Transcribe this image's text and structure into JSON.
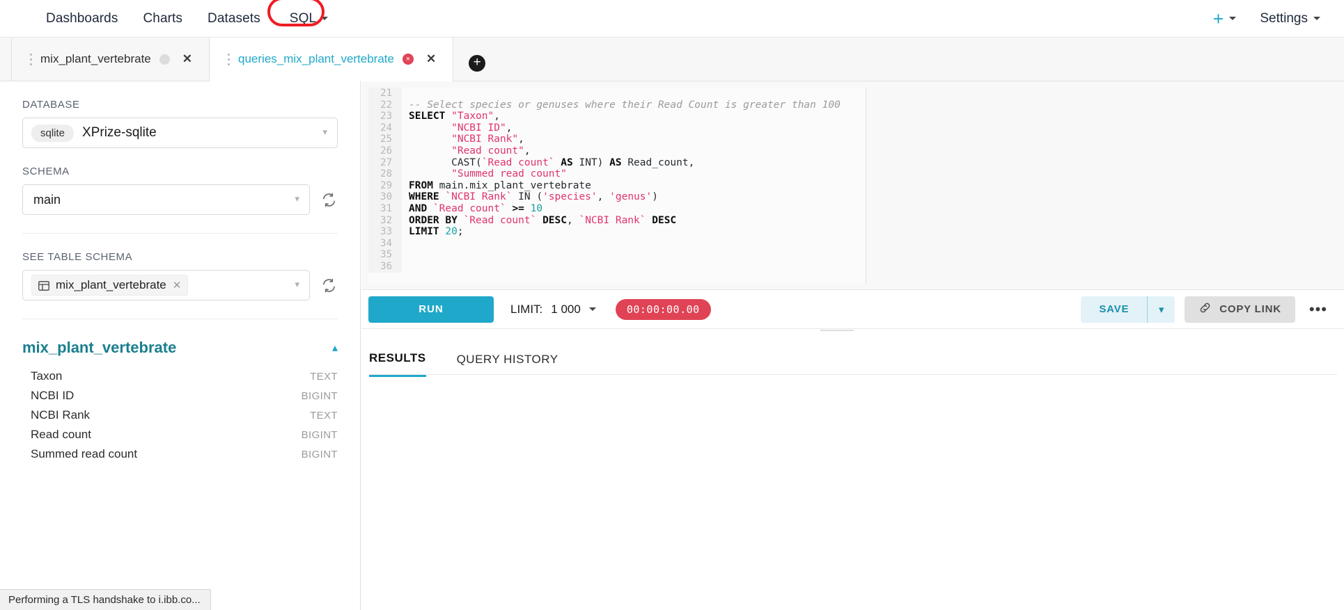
{
  "topnav": {
    "items": [
      {
        "label": "Dashboards",
        "caret": false
      },
      {
        "label": "Charts",
        "caret": false
      },
      {
        "label": "Datasets",
        "caret": false
      },
      {
        "label": "SQL",
        "caret": true,
        "highlighted": true
      }
    ],
    "settings_label": "Settings",
    "highlight_color": "#ee1c25",
    "accent_color": "#1fa8c9"
  },
  "tabs": [
    {
      "label": "mix_plant_vertebrate",
      "active": false,
      "status": "idle",
      "close": "✕"
    },
    {
      "label": "queries_mix_plant_vertebrate",
      "active": true,
      "status": "error",
      "badge": "×",
      "close": "✕"
    }
  ],
  "tab_add_label": "+",
  "sidebar": {
    "database_label": "DATABASE",
    "database_pill": "sqlite",
    "database_value": "XPrize-sqlite",
    "schema_label": "SCHEMA",
    "schema_value": "main",
    "see_table_schema_label": "SEE TABLE SCHEMA",
    "table_tag": "mix_plant_vertebrate",
    "table_tag_remove": "✕",
    "schema_panel_title": "mix_plant_vertebrate",
    "columns": [
      {
        "name": "Taxon",
        "type": "TEXT"
      },
      {
        "name": "NCBI ID",
        "type": "BIGINT"
      },
      {
        "name": "NCBI Rank",
        "type": "TEXT"
      },
      {
        "name": "Read count",
        "type": "BIGINT"
      },
      {
        "name": "Summed read count",
        "type": "BIGINT"
      }
    ]
  },
  "editor": {
    "first_line_number": 21,
    "lines": [
      {
        "n": 21,
        "tokens": []
      },
      {
        "n": 22,
        "tokens": [
          {
            "t": "cmt",
            "v": "-- Select species or genuses where their Read Count is greater than 100"
          }
        ]
      },
      {
        "n": 23,
        "tokens": [
          {
            "t": "kw",
            "v": "SELECT"
          },
          {
            "t": "pun",
            "v": " "
          },
          {
            "t": "str",
            "v": "\"Taxon\""
          },
          {
            "t": "pun",
            "v": ","
          }
        ]
      },
      {
        "n": 24,
        "tokens": [
          {
            "t": "pun",
            "v": "       "
          },
          {
            "t": "str",
            "v": "\"NCBI ID\""
          },
          {
            "t": "pun",
            "v": ","
          }
        ]
      },
      {
        "n": 25,
        "tokens": [
          {
            "t": "pun",
            "v": "       "
          },
          {
            "t": "str",
            "v": "\"NCBI Rank\""
          },
          {
            "t": "pun",
            "v": ","
          }
        ]
      },
      {
        "n": 26,
        "tokens": [
          {
            "t": "pun",
            "v": "       "
          },
          {
            "t": "str",
            "v": "\"Read count\""
          },
          {
            "t": "pun",
            "v": ","
          }
        ]
      },
      {
        "n": 27,
        "tokens": [
          {
            "t": "pun",
            "v": "       CAST("
          },
          {
            "t": "str",
            "v": "`Read count`"
          },
          {
            "t": "pun",
            "v": " "
          },
          {
            "t": "kw",
            "v": "AS"
          },
          {
            "t": "pun",
            "v": " INT) "
          },
          {
            "t": "kw",
            "v": "AS"
          },
          {
            "t": "pun",
            "v": " Read_count,"
          }
        ]
      },
      {
        "n": 28,
        "tokens": [
          {
            "t": "pun",
            "v": "       "
          },
          {
            "t": "str",
            "v": "\"Summed read count\""
          }
        ]
      },
      {
        "n": 29,
        "tokens": [
          {
            "t": "kw",
            "v": "FROM"
          },
          {
            "t": "pun",
            "v": " main.mix_plant_vertebrate"
          }
        ]
      },
      {
        "n": 30,
        "tokens": [
          {
            "t": "kw",
            "v": "WHERE"
          },
          {
            "t": "pun",
            "v": " "
          },
          {
            "t": "str",
            "v": "`NCBI Rank`"
          },
          {
            "t": "pun",
            "v": " IN ("
          },
          {
            "t": "str",
            "v": "'species'"
          },
          {
            "t": "pun",
            "v": ", "
          },
          {
            "t": "str",
            "v": "'genus'"
          },
          {
            "t": "pun",
            "v": ")"
          }
        ]
      },
      {
        "n": 31,
        "tokens": [
          {
            "t": "kw",
            "v": "AND"
          },
          {
            "t": "pun",
            "v": " "
          },
          {
            "t": "str",
            "v": "`Read count`"
          },
          {
            "t": "pun",
            "v": " "
          },
          {
            "t": "kw",
            "v": ">="
          },
          {
            "t": "pun",
            "v": " "
          },
          {
            "t": "num",
            "v": "10"
          }
        ]
      },
      {
        "n": 32,
        "tokens": [
          {
            "t": "kw",
            "v": "ORDER BY"
          },
          {
            "t": "pun",
            "v": " "
          },
          {
            "t": "str",
            "v": "`Read count`"
          },
          {
            "t": "pun",
            "v": " "
          },
          {
            "t": "kw",
            "v": "DESC"
          },
          {
            "t": "pun",
            "v": ", "
          },
          {
            "t": "str",
            "v": "`NCBI Rank`"
          },
          {
            "t": "pun",
            "v": " "
          },
          {
            "t": "kw",
            "v": "DESC"
          }
        ]
      },
      {
        "n": 33,
        "tokens": [
          {
            "t": "kw",
            "v": "LIMIT"
          },
          {
            "t": "pun",
            "v": " "
          },
          {
            "t": "num",
            "v": "20"
          },
          {
            "t": "pun",
            "v": ";"
          }
        ]
      },
      {
        "n": 34,
        "tokens": []
      },
      {
        "n": 35,
        "tokens": []
      },
      {
        "n": 36,
        "tokens": []
      }
    ]
  },
  "toolbar": {
    "run_label": "RUN",
    "limit_label": "LIMIT:",
    "limit_value": "1 000",
    "timer_value": "00:00:00.00",
    "timer_color": "#e04355",
    "save_label": "SAVE",
    "copy_link_label": "COPY LINK",
    "more_label": "•••"
  },
  "results": {
    "tabs": [
      {
        "label": "RESULTS",
        "active": true
      },
      {
        "label": "QUERY HISTORY",
        "active": false
      }
    ]
  },
  "statusbar": {
    "text": "Performing a TLS handshake to i.ibb.co..."
  }
}
